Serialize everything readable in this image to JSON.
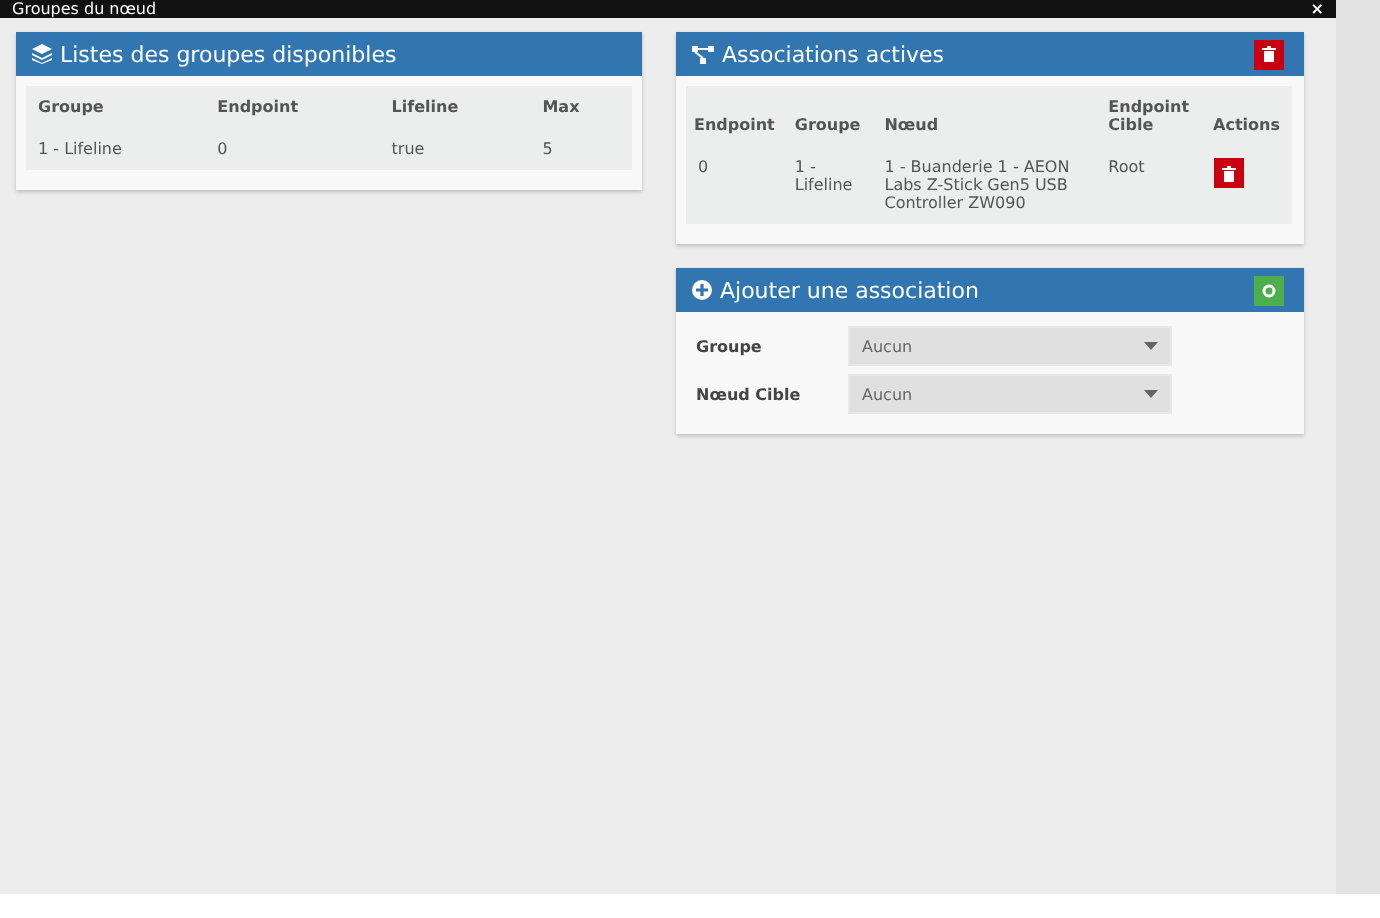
{
  "window": {
    "title": "Groupes du nœud",
    "close": "×"
  },
  "groups_panel": {
    "title": "Listes des groupes disponibles",
    "columns": [
      "Groupe",
      "Endpoint",
      "Lifeline",
      "Max"
    ],
    "rows": [
      [
        "1 - Lifeline",
        "0",
        "true",
        "5"
      ]
    ]
  },
  "associations_panel": {
    "title": "Associations actives",
    "columns": [
      "Endpoint",
      "Groupe",
      "Nœud",
      "Endpoint Cible",
      "Actions"
    ],
    "rows": [
      [
        "0",
        "1 - Lifeline",
        "1 - Buanderie 1 - AEON Labs Z-Stick Gen5 USB Controller ZW090",
        "Root"
      ]
    ]
  },
  "add_panel": {
    "title": "Ajouter une association",
    "fields": [
      {
        "label": "Groupe",
        "value": "Aucun"
      },
      {
        "label": "Nœud Cible",
        "value": "Aucun"
      }
    ]
  }
}
